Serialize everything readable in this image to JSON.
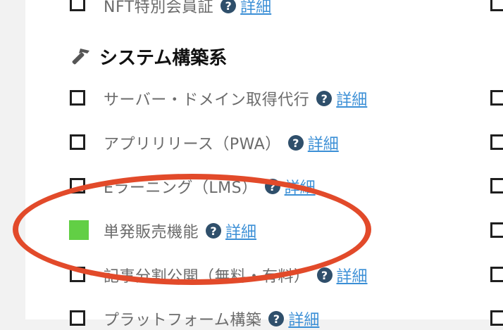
{
  "section": {
    "title": "システム構築系",
    "icon": "hammer-icon"
  },
  "help_symbol": "?",
  "rows": [
    {
      "label": "NFT特別会員証",
      "detail": "詳細",
      "checked": false
    },
    {
      "label": "サーバー・ドメイン取得代行",
      "detail": "詳細",
      "checked": false
    },
    {
      "label": "アプリリリース（PWA）",
      "detail": "詳細",
      "checked": false
    },
    {
      "label": "Eラーニング（LMS）",
      "detail": "詳細",
      "checked": false
    },
    {
      "label": "単発販売機能",
      "detail": "詳細",
      "checked": true
    },
    {
      "label": "記事分割公開（無料・有料）",
      "detail": "詳細",
      "checked": false
    },
    {
      "label": "プラットフォーム構築",
      "detail": "詳細",
      "checked": false
    }
  ],
  "colors": {
    "checked": "#62cf45",
    "link": "#3b8fd6",
    "annotation": "#e24a2a",
    "help_bg": "#2f4f6b"
  }
}
